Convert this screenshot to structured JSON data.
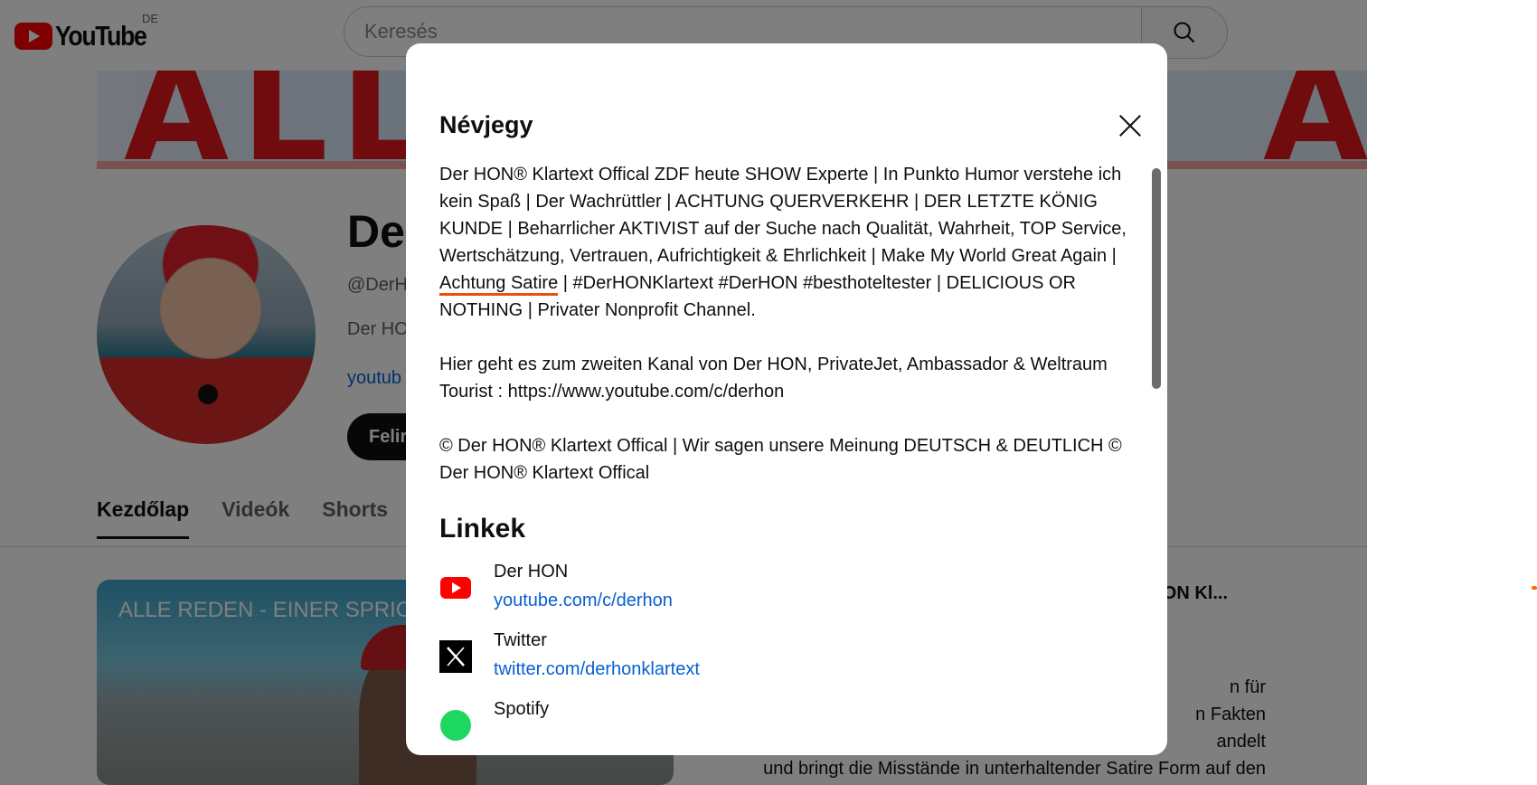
{
  "masthead": {
    "logo_text": "YouTube",
    "country_code": "DE",
    "search_placeholder": "Keresés"
  },
  "channel": {
    "name": "Der HON",
    "handle": "@DerH",
    "description_excerpt": "Der HO",
    "link_excerpt": "youtub",
    "subscribe_label": "Felir"
  },
  "banner": {
    "text_left": "ALL",
    "text_right": "A"
  },
  "tabs": [
    {
      "label": "Kezdőlap",
      "active": true
    },
    {
      "label": "Videók",
      "active": false
    },
    {
      "label": "Shorts",
      "active": false
    }
  ],
  "video": {
    "thumb_title": "ALLE REDEN - EINER SPRIC",
    "side_title": "r HON Kl...",
    "side_lines": [
      "n für",
      "n Fakten",
      "andelt",
      "und bringt die Misstände in unterhaltender Satire Form auf den"
    ]
  },
  "dialog": {
    "title": "Névjegy",
    "about": {
      "p1_before": "Der HON® Klartext Offical ZDF heute SHOW Experte | In Punkto Humor verstehe ich kein Spaß | Der Wachrüttler | ACHTUNG QUERVERKEHR | DER LETZTE KÖNIG KUNDE | Beharrlicher AKTIVIST auf der Suche nach Qualität, Wahrheit, TOP Service,  Wertschätzung, Vertrauen, Aufrichtigkeit & Ehrlichkeit | Make My World Great Again | ",
      "p1_highlight": "Achtung Satire",
      "p1_after": " | #DerHONKlartext #DerHON #besthoteltester  | DELICIOUS OR NOTHING | Privater Nonprofit Channel.",
      "p2": "Hier geht es zum zweiten Kanal von Der HON, PrivateJet, Ambassador & Weltraum Tourist : https://www.youtube.com/c/derhon",
      "p3": "© Der HON® Klartext Offical | Wir sagen unsere Meinung DEUTSCH & DEUTLICH © Der HON® Klartext Offical"
    },
    "links_title": "Linkek",
    "links": [
      {
        "name": "Der HON",
        "url": "youtube.com/c/derhon",
        "icon": "youtube-icon"
      },
      {
        "name": "Twitter",
        "url": "twitter.com/derhonklartext",
        "icon": "x-twitter-icon"
      },
      {
        "name": "Spotify",
        "url": "",
        "icon": "spotify-icon"
      }
    ]
  },
  "colors": {
    "link_blue": "#065fd4",
    "highlight_underline": "#e8500c",
    "youtube_red": "#ff0000",
    "spotify_green": "#1ed760"
  }
}
